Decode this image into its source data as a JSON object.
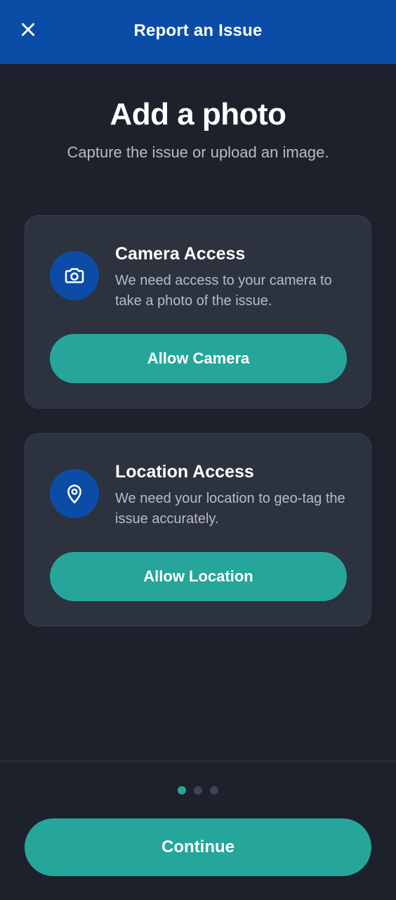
{
  "header": {
    "title": "Report an Issue",
    "close_icon": "close-icon"
  },
  "main": {
    "title": "Add a photo",
    "subtitle": "Capture the issue or upload an image."
  },
  "cards": [
    {
      "icon": "camera-icon",
      "title": "Camera Access",
      "description": "We need access to your camera to take a photo of the issue.",
      "button_label": "Allow Camera"
    },
    {
      "icon": "location-pin-icon",
      "title": "Location Access",
      "description": "We need your location to geo-tag the issue accurately.",
      "button_label": "Allow Location"
    }
  ],
  "pagination": {
    "total": 3,
    "active_index": 0
  },
  "footer": {
    "continue_label": "Continue"
  },
  "colors": {
    "header_bg": "#0b4da6",
    "background": "#1c212c",
    "card_bg": "#2c323e",
    "accent": "#26a69a",
    "muted_text": "#b7bcc6"
  }
}
